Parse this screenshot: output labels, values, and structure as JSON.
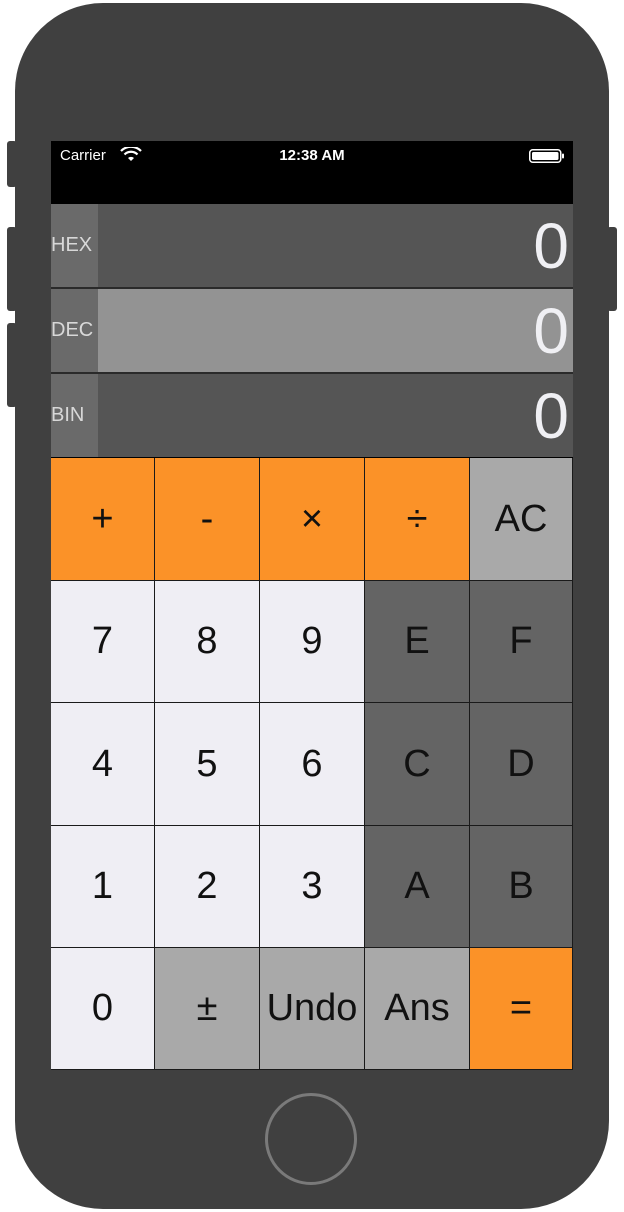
{
  "status": {
    "carrier": "Carrier",
    "time": "12:38 AM"
  },
  "display": {
    "hex": {
      "label": "HEX",
      "value": "0"
    },
    "dec": {
      "label": "DEC",
      "value": "0"
    },
    "bin": {
      "label": "BIN",
      "value": "0"
    }
  },
  "keys": {
    "row1": [
      "+",
      "-",
      "×",
      "÷",
      "AC"
    ],
    "row2": [
      "7",
      "8",
      "9",
      "E",
      "F"
    ],
    "row3": [
      "4",
      "5",
      "6",
      "C",
      "D"
    ],
    "row4": [
      "1",
      "2",
      "3",
      "A",
      "B"
    ],
    "row5": [
      "0",
      "±",
      "Undo",
      "Ans",
      "="
    ]
  },
  "colors": {
    "orange": "#fb9228",
    "light": "#efeef4",
    "dark": "#646464",
    "grey": "#a9a9a9"
  }
}
